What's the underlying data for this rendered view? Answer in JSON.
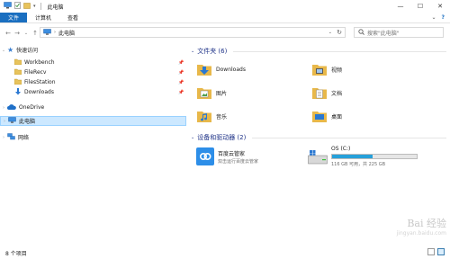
{
  "window": {
    "title": "此电脑"
  },
  "ribbon": {
    "tabs": [
      {
        "label": "文件"
      },
      {
        "label": "计算机"
      },
      {
        "label": "查看"
      }
    ]
  },
  "address": {
    "path": "此电脑"
  },
  "search": {
    "placeholder": "搜索\"此电脑\""
  },
  "nav": {
    "quick_access": "快速访问",
    "items": [
      {
        "label": "Workbench",
        "icon": "folder-icon"
      },
      {
        "label": "FileRecv",
        "icon": "folder-icon"
      },
      {
        "label": "FilesStation",
        "icon": "folder-icon"
      },
      {
        "label": "Downloads",
        "icon": "download-arrow-icon"
      }
    ],
    "onedrive": "OneDrive",
    "this_pc": "此电脑",
    "network": "网络"
  },
  "folders": {
    "header": "文件夹 (6)",
    "items": [
      {
        "label": "Downloads"
      },
      {
        "label": "视频"
      },
      {
        "label": "图片"
      },
      {
        "label": "文档"
      },
      {
        "label": "音乐"
      },
      {
        "label": "桌面"
      }
    ]
  },
  "devices": {
    "header": "设备和驱动器 (2)",
    "baidu": {
      "name": "百度云管家",
      "sub": "双击运行百度云管家"
    },
    "drive": {
      "name": "OS (C:)",
      "free": "116 GB 可用，共 225 GB",
      "used_fraction": 0.48
    }
  },
  "status": {
    "count": "8 个项目"
  },
  "watermark": {
    "line1": "Bai 经验",
    "line2": "jingyan.baidu.com"
  },
  "colors": {
    "accent": "#1a6fc0",
    "selection": "#cce8ff",
    "drive_fill": "#26a0da",
    "folder": "#e8b84a"
  }
}
